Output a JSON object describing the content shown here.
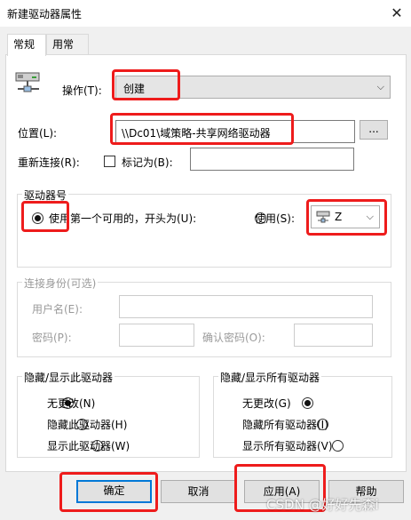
{
  "window": {
    "title": "新建驱动器属性",
    "close_icon": "close-icon"
  },
  "tabs": [
    {
      "label": "常规"
    },
    {
      "label": "用常"
    }
  ],
  "action": {
    "label": "操作(T):",
    "value": "创建"
  },
  "location": {
    "label": "位置(L):",
    "value": "\\\\Dc01\\域策略-共享网络驱动器",
    "browse_label": "..."
  },
  "reconnect": {
    "label": "重新连接(R):",
    "checkbox_label": "标记为(B):",
    "label_value": ""
  },
  "drive_letter": {
    "group_label": "驱动器号",
    "first_available_label": "使用第一个可用的，开头为(U):",
    "use_label": "使用(S):",
    "selected_drive": "Z"
  },
  "credentials": {
    "group_label": "连接身份(可选)",
    "username_label": "用户名(E):",
    "password_label": "密码(P):",
    "confirm_label": "确认密码(O):"
  },
  "hide_this": {
    "group_label": "隐藏/显示此驱动器",
    "options": [
      "无更改(N)",
      "隐藏此驱动器(H)",
      "显示此驱动器(W)"
    ]
  },
  "hide_all": {
    "group_label": "隐藏/显示所有驱动器",
    "options": [
      "无更改(G)",
      "隐藏所有驱动器(I)",
      "显示所有驱动器(V)"
    ]
  },
  "buttons": {
    "ok": "确定",
    "cancel": "取消",
    "apply": "应用(A)",
    "help": "帮助"
  },
  "watermark": "CSDN @好好先森i",
  "colors": {
    "highlight": "#ee1c1c",
    "focus": "#0078d7"
  }
}
